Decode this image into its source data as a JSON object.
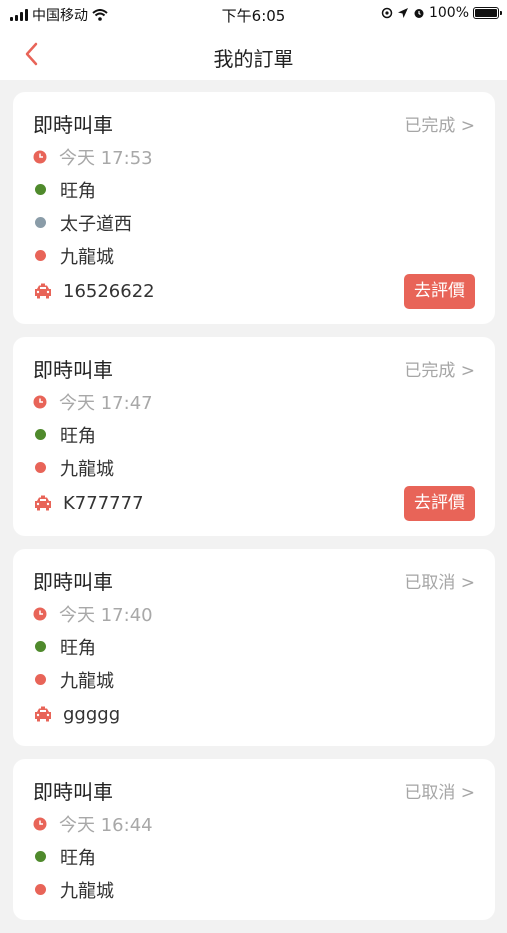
{
  "status_bar": {
    "carrier": "中国移动",
    "time": "下午6:05",
    "battery": "100%"
  },
  "nav": {
    "title": "我的訂單"
  },
  "colors": {
    "accent": "#e86458",
    "pickup_dot": "#4f8a2c",
    "via_dot": "#8a9ca8",
    "dest_dot": "#e86458"
  },
  "orders": [
    {
      "title": "即時叫車",
      "status": "已完成 >",
      "time": "今天 17:53",
      "pickup": "旺角",
      "via": "太子道西",
      "destination": "九龍城",
      "plate": "16526622",
      "rate_label": "去評價"
    },
    {
      "title": "即時叫車",
      "status": "已完成 >",
      "time": "今天 17:47",
      "pickup": "旺角",
      "destination": "九龍城",
      "plate": "K777777",
      "rate_label": "去評價"
    },
    {
      "title": "即時叫車",
      "status": "已取消 >",
      "time": "今天 17:40",
      "pickup": "旺角",
      "destination": "九龍城",
      "plate": "ggggg"
    },
    {
      "title": "即時叫車",
      "status": "已取消 >",
      "time": "今天 16:44",
      "pickup": "旺角",
      "destination": "九龍城"
    }
  ]
}
